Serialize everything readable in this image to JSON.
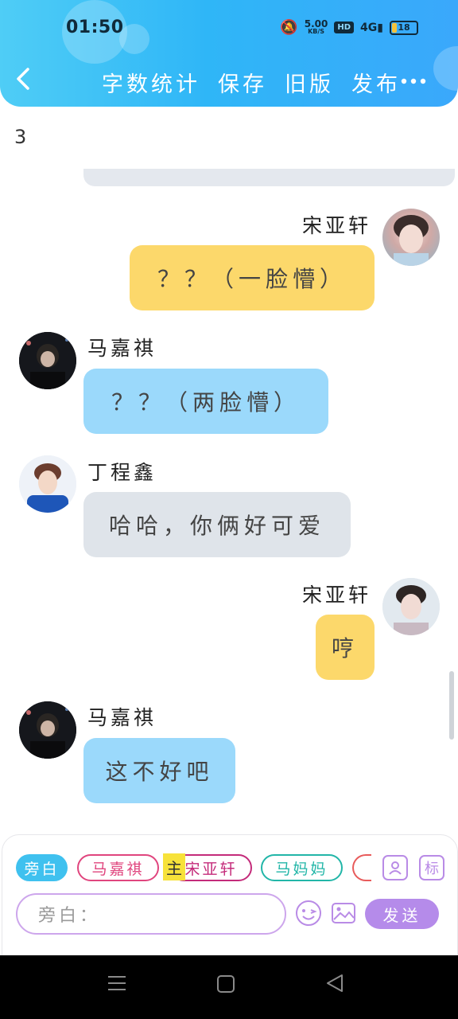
{
  "status_bar": {
    "time": "01:50",
    "net_speed": "5.00",
    "net_unit": "KB/S",
    "hd": "HD",
    "signal": "4G",
    "battery": "18"
  },
  "header": {
    "back_icon": "chevron-left-icon",
    "actions": [
      "字数统计",
      "保存",
      "旧版",
      "发布"
    ],
    "more_icon": "more-dots-icon"
  },
  "stray_text": "3",
  "messages": [
    {
      "speaker": "宋亚轩",
      "text": "？？（一脸懵）",
      "side": "right",
      "color": "#fcd86b"
    },
    {
      "speaker": "马嘉祺",
      "text": "？？（两脸懵）",
      "side": "left",
      "color": "#9bd9fb"
    },
    {
      "speaker": "丁程鑫",
      "text": "哈哈，你俩好可爱",
      "side": "left",
      "color": "#dfe4ea"
    },
    {
      "speaker": "宋亚轩",
      "text": "哼",
      "side": "right",
      "color": "#fcd86b"
    },
    {
      "speaker": "马嘉祺",
      "text": "这不好吧",
      "side": "left",
      "color": "#9bd9fb"
    }
  ],
  "composer": {
    "roles": [
      "旁白",
      "马嘉祺",
      "宋亚轩",
      "马妈妈"
    ],
    "main_tag": "主",
    "role_icon": "person-card-icon",
    "tag_label": "标",
    "input_placeholder": "旁白：",
    "emoji_icon": "emoji-icon",
    "image_icon": "image-icon",
    "send_label": "发送"
  },
  "system_nav": {
    "menu_icon": "menu-icon",
    "home_icon": "home-square-icon",
    "back_icon": "back-triangle-icon"
  }
}
